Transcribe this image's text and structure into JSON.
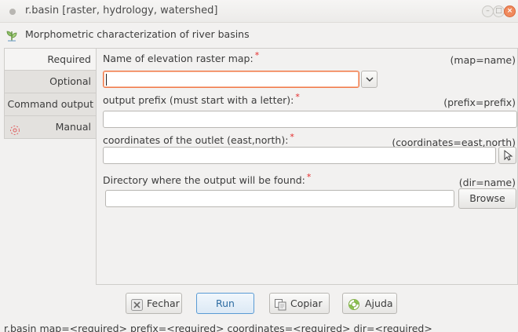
{
  "window": {
    "title": "r.basin [raster, hydrology, watershed]",
    "controls": {
      "minimize": "–",
      "maximize": "□",
      "close": "×"
    }
  },
  "header": {
    "text": "Morphometric characterization of river basins",
    "icon": "watershed-leaf-icon"
  },
  "tabs": [
    {
      "label": "Required",
      "active": true
    },
    {
      "label": "Optional",
      "active": false
    },
    {
      "label": "Command output",
      "active": false
    },
    {
      "label": "Manual",
      "active": false,
      "icon": "manual-help-icon"
    }
  ],
  "fields": {
    "elevation": {
      "label": "Name of elevation raster map:",
      "required_mark": "*",
      "key": "(map=name)",
      "value": ""
    },
    "prefix": {
      "label": "output prefix (must start with a letter):",
      "required_mark": "*",
      "key": "(prefix=prefix)",
      "value": ""
    },
    "coordinates": {
      "label": "coordinates of the outlet (east,north):",
      "required_mark": "*",
      "key": "(coordinates=east,north)",
      "value": ""
    },
    "dir": {
      "label": "Directory where the output will be found:",
      "required_mark": "*",
      "key": "(dir=name)",
      "value": "",
      "browse_label": "Browse"
    }
  },
  "buttons": {
    "close": "Fechar",
    "run": "Run",
    "copy": "Copiar",
    "help": "Ajuda"
  },
  "status": "r.basin map=<required> prefix=<required> coordinates=<required> dir=<required>",
  "colors": {
    "required": "#e52b2b",
    "focus": "#f07746",
    "run_border": "#5a9bd4",
    "close_button": "#f08a5d"
  }
}
